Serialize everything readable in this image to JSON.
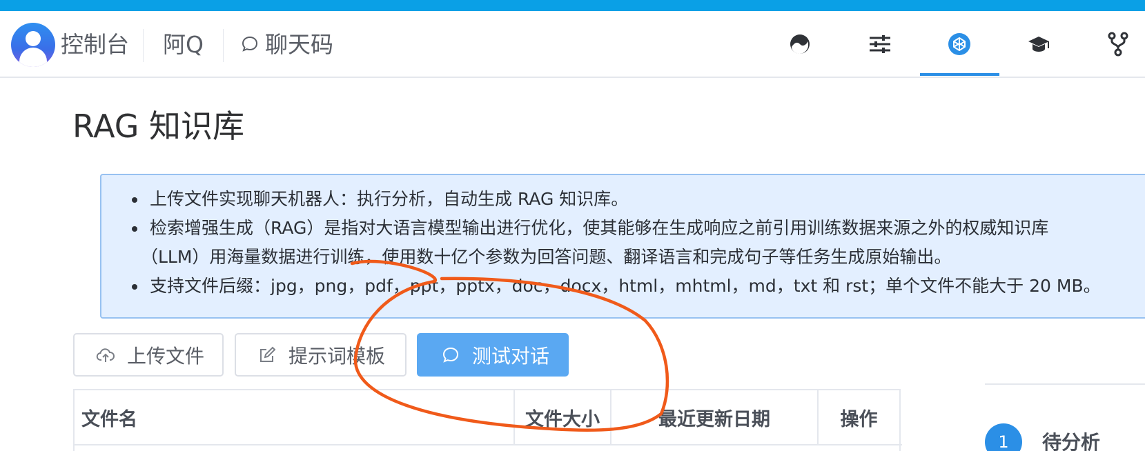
{
  "header": {
    "console_label": "控制台",
    "nav_items": [
      "阿Q",
      "聊天码"
    ],
    "icons": [
      "dashboard-icon",
      "sliders-icon",
      "codepen-icon",
      "graduation-cap-icon",
      "fork-icon"
    ],
    "active_icon": "codepen-icon"
  },
  "page": {
    "title": "RAG 知识库"
  },
  "info": {
    "items": [
      "上传文件实现聊天机器人：执行分析，自动生成 RAG 知识库。",
      "检索增强生成（RAG）是指对大语言模型输出进行优化，使其能够在生成响应之前引用训练数据来源之外的权威知识库",
      "（LLM）用海量数据进行训练，使用数十亿个参数为回答问题、翻译语言和完成句子等任务生成原始输出。",
      "支持文件后缀：jpg，png，pdf，ppt，pptx，doc，docx，html，mhtml，md，txt 和 rst；单个文件不能大于 20 MB。"
    ]
  },
  "toolbar": {
    "upload_label": "上传文件",
    "prompt_template_label": "提示词模板",
    "test_chat_label": "测试对话"
  },
  "table": {
    "columns": [
      "文件名",
      "文件大小",
      "最近更新日期",
      "操作"
    ]
  },
  "steps": {
    "current_number": "1",
    "current_label": "待分析"
  },
  "colors": {
    "topbar": "#0aa0e6",
    "accent": "#2b8fe6",
    "primary_button": "#5aa8f2",
    "info_bg": "#e3efff",
    "annotation": "#f05a1a"
  }
}
